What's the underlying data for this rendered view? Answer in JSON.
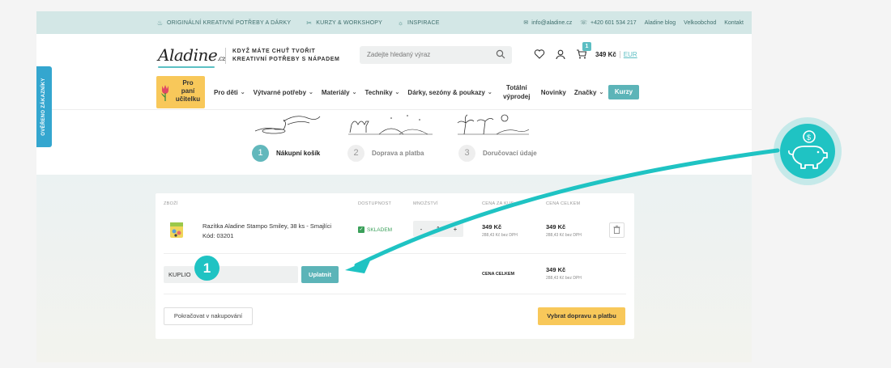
{
  "topbar": {
    "items": [
      {
        "icon": "pot-icon",
        "label": "Originální kreativní potřeby a dárky"
      },
      {
        "icon": "scissors-icon",
        "label": "Kurzy & workshopy"
      },
      {
        "icon": "bulb-icon",
        "label": "Inspirace"
      }
    ],
    "email": "info@aladine.cz",
    "phone": "+420 601 534 217",
    "links": [
      "Aladine blog",
      "Velkoobchod",
      "Kontakt"
    ]
  },
  "header": {
    "logo": "Aladine",
    "logo_suffix": ".cz",
    "tagline_line1": "KDYŽ MÁTE CHUŤ TVOŘIT",
    "tagline_line2": "KREATIVNÍ POTŘEBY S NÁPADEM",
    "search_placeholder": "Zadejte hledaný výraz",
    "cart_count": "1",
    "cart_price": "349 Kč",
    "currency_switch": "EUR"
  },
  "nav": {
    "teacher_line1": "Pro",
    "teacher_line2": "paní",
    "teacher_line3": "učitelku",
    "items": [
      {
        "label": "Pro děti",
        "dropdown": true
      },
      {
        "label": "Výtvarné potřeby",
        "dropdown": true
      },
      {
        "label": "Materiály",
        "dropdown": true
      },
      {
        "label": "Techniky",
        "dropdown": true
      },
      {
        "label": "Dárky, sezóny & poukazy",
        "dropdown": true
      },
      {
        "label": "Totální výprodej",
        "dropdown": false
      },
      {
        "label": "Novinky",
        "dropdown": false
      },
      {
        "label": "Značky",
        "dropdown": true
      }
    ],
    "cta": "Kurzy"
  },
  "steps": [
    {
      "num": "1",
      "label": "Nákupní košík",
      "active": true
    },
    {
      "num": "2",
      "label": "Doprava a platba",
      "active": false
    },
    {
      "num": "3",
      "label": "Doručovací údaje",
      "active": false
    }
  ],
  "cart": {
    "headers": {
      "product": "Zboží",
      "availability": "Dostupnost",
      "qty": "Množství",
      "unit_price": "Cena za kus",
      "total": "Cena celkem"
    },
    "item": {
      "name": "Razítka Aladine Stampo Smiley, 38 ks - Smajlíci",
      "code": "Kód: 03201",
      "availability": "SKLADEM",
      "qty": "1",
      "qty_minus": "-",
      "qty_plus": "+",
      "unit_price": "349 Kč",
      "unit_price_ex_vat": "288,43 Kč bez DPH",
      "total_price": "349 Kč",
      "total_price_ex_vat": "288,43 Kč bez DPH"
    },
    "coupon_value": "KUPLIO",
    "apply_label": "Uplatnit",
    "total_label": "CENA CELKEM",
    "grand_total": "349 Kč",
    "grand_total_ex_vat": "288,43 Kč bez DPH",
    "continue_label": "Pokračovat v nakupování",
    "next_label": "Vybrat dopravu a platbu"
  },
  "sidetab": "OVĚŘENO ZÁKAZNÍKY",
  "annotation": {
    "marker": "1",
    "accent": "#1fc3c3"
  }
}
